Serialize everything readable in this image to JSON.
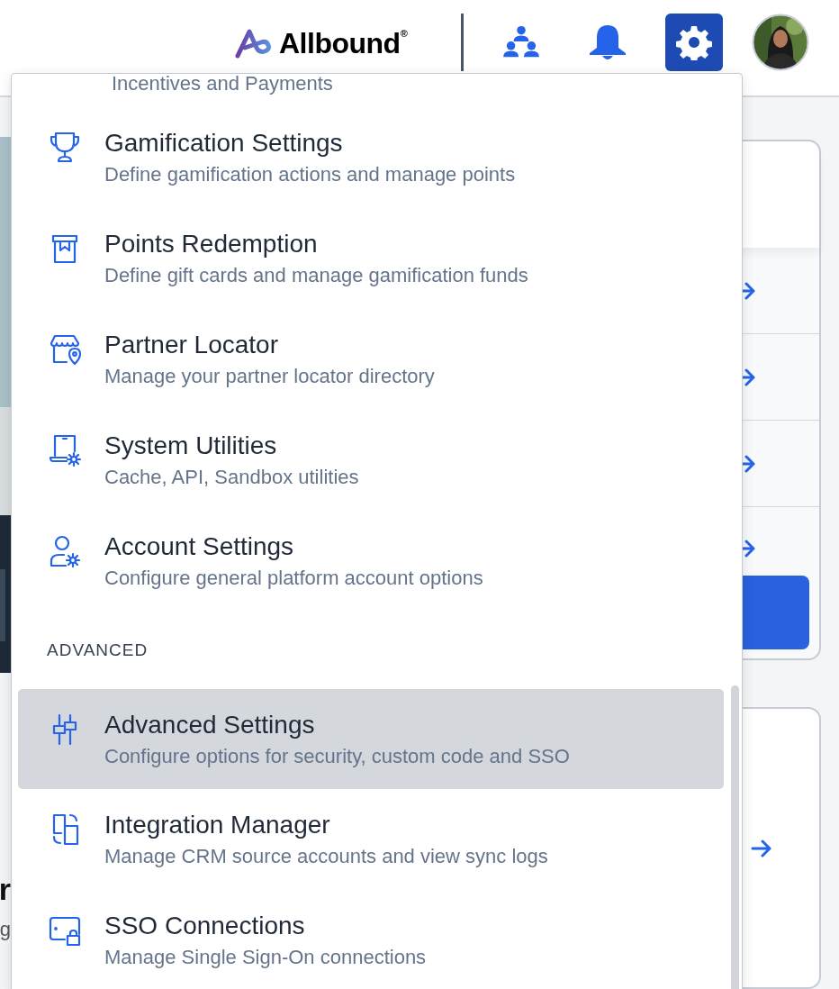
{
  "header": {
    "logo": "Allbound$^{®}$",
    "buttons": [
      {
        "kind": "people",
        "selected": false
      },
      {
        "kind": "bell",
        "selected": false
      },
      {
        "kind": "gear",
        "selected": true
      }
    ]
  },
  "background": {
    "heading_fragment": "r",
    "text_fragment": "g"
  },
  "menu": {
    "entries": [
      {
        "kind": "clipped",
        "subtitle": "Incentives and Payments"
      },
      {
        "kind": "item",
        "title": "Gamification Settings",
        "subtitle": "Define gamification actions and manage points",
        "selected": false
      },
      {
        "kind": "item",
        "title": "Points Redemption",
        "subtitle": "Define gift cards and manage gamification funds",
        "selected": false
      },
      {
        "kind": "item",
        "title": "Partner Locator",
        "subtitle": "Manage your partner locator directory",
        "selected": false
      },
      {
        "kind": "item",
        "title": "System Utilities",
        "subtitle": "Cache, API, Sandbox utilities",
        "selected": false
      },
      {
        "kind": "item",
        "title": "Account Settings",
        "subtitle": "Configure general platform account options",
        "selected": false
      },
      {
        "kind": "heading",
        "label": "ADVANCED"
      },
      {
        "kind": "item",
        "title": "Advanced Settings",
        "subtitle": "Configure options for security, custom code and SSO",
        "selected": true
      },
      {
        "kind": "item",
        "title": "Integration Manager",
        "subtitle": "Manage CRM source accounts and view sync logs",
        "selected": false
      },
      {
        "kind": "item",
        "title": "SSO Connections",
        "subtitle": "Manage Single Sign-On connections",
        "selected": false
      }
    ]
  }
}
